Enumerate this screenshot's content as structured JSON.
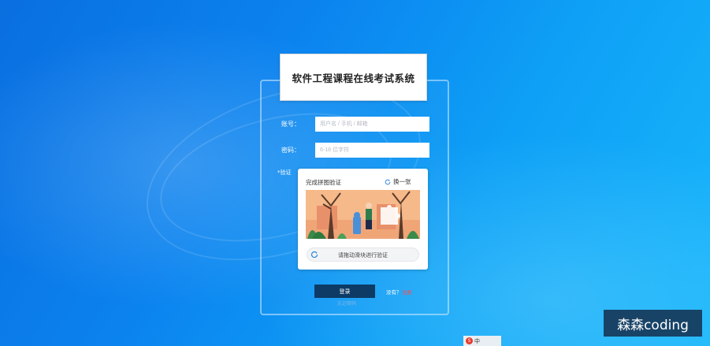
{
  "app": {
    "title": "软件工程课程在线考试系统"
  },
  "form": {
    "account_label": "账号：",
    "account_placeholder": "用户名 / 手机 / 邮箱",
    "password_label": "密码：",
    "password_placeholder": "6-18 位字符",
    "captcha_label": "*验证"
  },
  "captcha": {
    "heading": "完成拼图验证",
    "refresh_label": "换一张",
    "slider_text": "请拖动滑块进行验证"
  },
  "actions": {
    "login_label": "登录",
    "register_prefix": "没有？",
    "register_link": "注册",
    "forgot_label": "忘记密码"
  },
  "overlay": {
    "watermark": "森森coding",
    "tray_ime": "中"
  },
  "colors": {
    "accent": "#0d3b66",
    "link": "#ff4d4f",
    "background": "#0b83ef"
  }
}
